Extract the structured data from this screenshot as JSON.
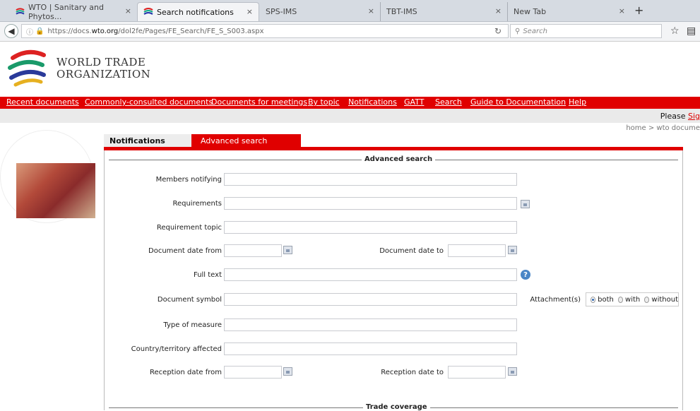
{
  "browser": {
    "tabs": [
      {
        "label": "WTO | Sanitary and Phytos...",
        "active": false
      },
      {
        "label": "Search notifications",
        "active": true
      },
      {
        "label": "SPS-IMS",
        "active": false
      },
      {
        "label": "TBT-IMS",
        "active": false
      },
      {
        "label": "New Tab",
        "active": false
      }
    ],
    "url_prefix": "https://docs.",
    "url_domain": "wto.org",
    "url_path": "/dol2fe/Pages/FE_Search/FE_S_S003.aspx",
    "search_placeholder": "Search"
  },
  "site": {
    "logo_line1": "WORLD TRADE",
    "logo_line2": "ORGANIZATION",
    "menu": [
      "Recent documents",
      "Commonly-consulted documents",
      "Documents for meetings",
      "By topic",
      "Notifications",
      "GATT",
      "Search",
      "Guide to Documentation",
      "Help"
    ],
    "please_text": "Please ",
    "please_link": "Sig",
    "breadcrumb": "home > wto docume"
  },
  "page": {
    "tab_notifications": "Notifications",
    "tab_advanced": "Advanced search",
    "section_title": "Advanced search",
    "section2_title": "Trade coverage",
    "fields": {
      "members": "Members notifying",
      "requirements": "Requirements",
      "requirement_topic": "Requirement topic",
      "doc_date_from": "Document date from",
      "doc_date_to": "Document date to",
      "full_text": "Full text",
      "doc_symbol": "Document symbol",
      "attachments": "Attachment(s)",
      "type_measure": "Type of measure",
      "country": "Country/territory affected",
      "recep_from": "Reception date from",
      "recep_to": "Reception date to"
    },
    "attachment_options": [
      "both",
      "with",
      "without"
    ],
    "attachment_selected": "both"
  },
  "colors": {
    "accent": "#e00000"
  }
}
